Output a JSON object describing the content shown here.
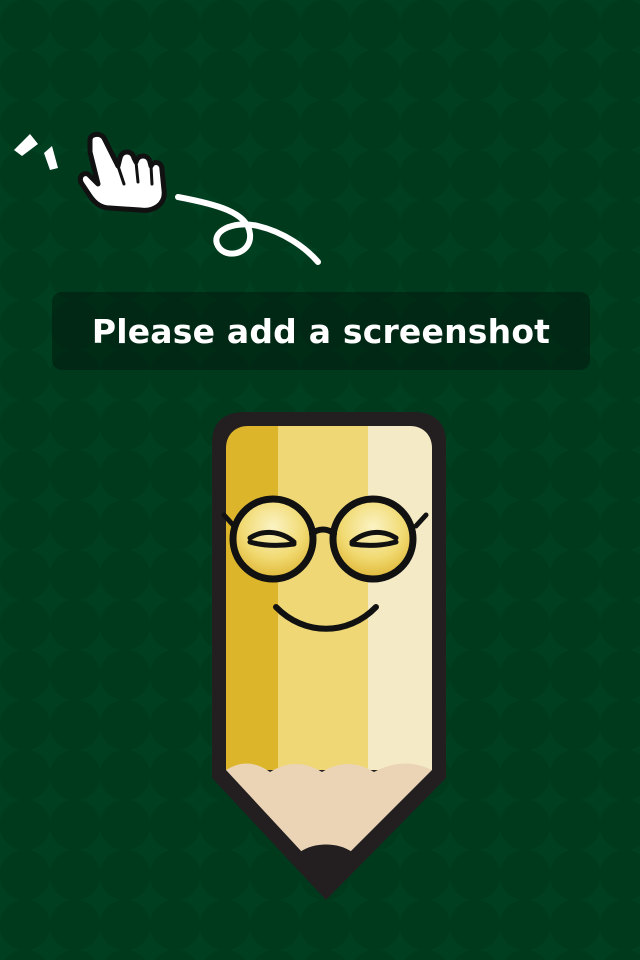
{
  "banner": {
    "message": "Please add a screenshot"
  },
  "hint": {
    "icon": "tap-hand-icon"
  },
  "mascot": {
    "icon": "pencil-mascot-icon"
  },
  "colors": {
    "background": "#004020",
    "pattern_dot": "#003a1d",
    "pencil_dark_yellow": "#ddb52b",
    "pencil_mid_yellow": "#efd776",
    "pencil_light_yellow": "#f5eac6",
    "pencil_outline": "#231f20",
    "pencil_wood": "#ead4b5",
    "banner_text": "#ffffff"
  }
}
